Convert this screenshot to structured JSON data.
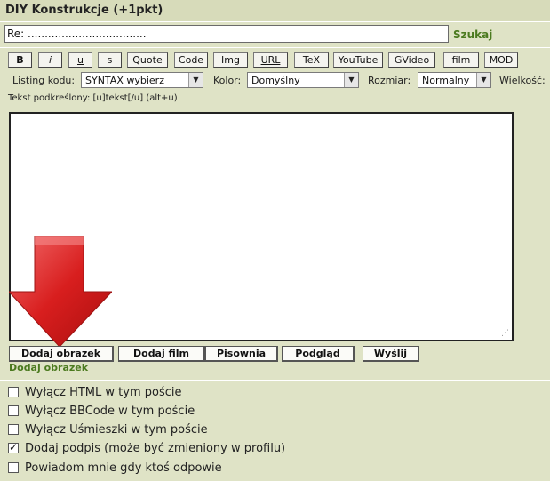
{
  "header": {
    "title": "DIY Konstrukcje (+1pkt)"
  },
  "subject": {
    "value": "Re: ..................................."
  },
  "search": {
    "label": "Szukaj"
  },
  "toolbar": {
    "buttons": [
      "B",
      "i",
      "u",
      "s",
      "Quote",
      "Code",
      "Img",
      "URL",
      "TeX",
      "YouTube",
      "GVideo",
      "film",
      "MOD"
    ]
  },
  "format": {
    "code_label": "Listing kodu:",
    "code_value": "SYNTAX wybierz",
    "color_label": "Kolor:",
    "color_value": "Domyślny",
    "size_label": "Rozmiar:",
    "size_value": "Normalny",
    "width_label": "Wielkość:"
  },
  "hint": "Tekst podkreślony: [u]tekst[/u]  (alt+u)",
  "editor": {
    "value": ""
  },
  "actions": {
    "add_image": "Dodaj obrazek",
    "add_film": "Dodaj film",
    "spelling": "Pisownia",
    "preview": "Podgląd",
    "send": "Wyślij"
  },
  "status_text": "Dodaj obrazek",
  "options": [
    {
      "label": "Wyłącz HTML w tym poście",
      "checked": false
    },
    {
      "label": "Wyłącz BBCode w tym poście",
      "checked": false
    },
    {
      "label": "Wyłącz Uśmieszki w tym poście",
      "checked": false
    },
    {
      "label": "Dodaj podpis (może być zmieniony w profilu)",
      "checked": true
    },
    {
      "label": "Powiadom mnie gdy ktoś odpowie",
      "checked": false
    }
  ],
  "colors": {
    "accent_green": "#4b7a1f",
    "background": "#dfe3c6",
    "arrow_red": "#d81e1e"
  }
}
